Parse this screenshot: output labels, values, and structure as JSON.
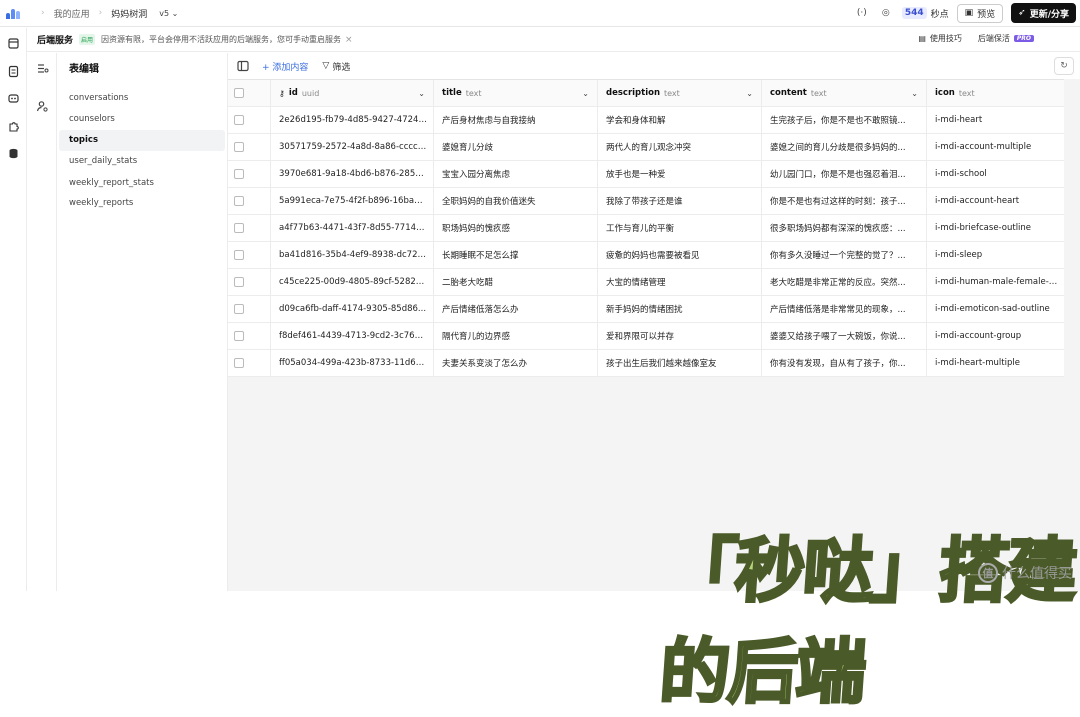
{
  "topbar": {
    "breadcrumb": [
      "我的应用",
      "妈妈树洞"
    ],
    "version": "v5",
    "seconds_count": "544",
    "seconds_label": "秒点",
    "preview_label": "预览",
    "publish_label": "更新/分享"
  },
  "service_bar": {
    "title": "后端服务",
    "tag": "启用",
    "message": "因资源有限，平台会停用不活跃应用的后端服务，您可手动重启服务",
    "tips_label": "使用技巧",
    "keepalive_label": "后端保活",
    "pro_badge": "PRO"
  },
  "tables_panel": {
    "heading": "表编辑",
    "tables": [
      "conversations",
      "counselors",
      "topics",
      "user_daily_stats",
      "weekly_report_stats",
      "weekly_reports"
    ],
    "active": "topics"
  },
  "toolbar": {
    "add_label": "+ 添加内容",
    "filter_label": "筛选"
  },
  "grid": {
    "columns": [
      {
        "name": "id",
        "type": "uuid"
      },
      {
        "name": "title",
        "type": "text"
      },
      {
        "name": "description",
        "type": "text"
      },
      {
        "name": "content",
        "type": "text"
      },
      {
        "name": "icon",
        "type": "text"
      }
    ],
    "rows": [
      [
        "2e26d195-fb79-4d85-9427-47243...",
        "产后身材焦虑与自我接纳",
        "学会和身体和解",
        "生完孩子后，你是不是也不敢照镜...",
        "i-mdi-heart"
      ],
      [
        "30571759-2572-4a8d-8a86-cccc3...",
        "婆媳育儿分歧",
        "两代人的育儿观念冲突",
        "婆媳之间的育儿分歧是很多妈妈的...",
        "i-mdi-account-multiple"
      ],
      [
        "3970e681-9a18-4bd6-b876-285cd...",
        "宝宝入园分离焦虑",
        "放手也是一种爱",
        "幼儿园门口，你是不是也强忍着泪...",
        "i-mdi-school"
      ],
      [
        "5a991eca-7e75-4f2f-b896-16ba93...",
        "全职妈妈的自我价值迷失",
        "我除了带孩子还是谁",
        "你是不是也有过这样的时刻：孩子...",
        "i-mdi-account-heart"
      ],
      [
        "a4f77b63-4471-43f7-8d55-77149e...",
        "职场妈妈的愧疚感",
        "工作与育儿的平衡",
        "很多职场妈妈都有深深的愧疚感：...",
        "i-mdi-briefcase-outline"
      ],
      [
        "ba41d816-35b4-4ef9-8938-dc72d...",
        "长期睡眠不足怎么撑",
        "疲惫的妈妈也需要被看见",
        "你有多久没睡过一个完整的觉了？...",
        "i-mdi-sleep"
      ],
      [
        "c45ce225-00d9-4805-89cf-52821...",
        "二胎老大吃醋",
        "大宝的情绪管理",
        "老大吃醋是非常正常的反应。突然...",
        "i-mdi-human-male-female-chil"
      ],
      [
        "d09ca6fb-daff-4174-9305-85d86...",
        "产后情绪低落怎么办",
        "新手妈妈的情绪困扰",
        "产后情绪低落是非常常见的现象，...",
        "i-mdi-emoticon-sad-outline"
      ],
      [
        "f8def461-4439-4713-9cd2-3c767a...",
        "隔代育儿的边界感",
        "爱和界限可以并存",
        "婆婆又给孩子喂了一大碗饭，你说...",
        "i-mdi-account-group"
      ],
      [
        "ff05a034-499a-423b-8733-11d69c...",
        "夫妻关系变淡了怎么办",
        "孩子出生后我们越来越像室友",
        "你有没有发现，自从有了孩子，你...",
        "i-mdi-heart-multiple"
      ]
    ]
  },
  "overlay": {
    "caption": "「秒哒」搭建的后端",
    "watermark_glyph": "值",
    "watermark_text": "什么值得买"
  }
}
